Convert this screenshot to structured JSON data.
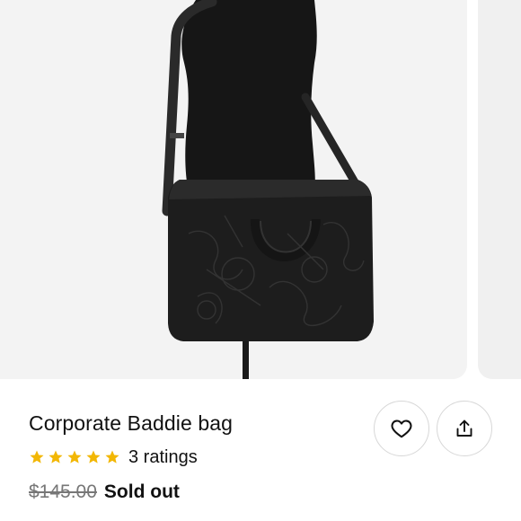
{
  "product": {
    "title": "Corporate Baddie bag",
    "rating_stars": 5,
    "rating_text": "3 ratings",
    "original_price": "$145.00",
    "status": "Sold out"
  },
  "actions": {
    "like_icon": "heart-icon",
    "share_icon": "share-icon"
  },
  "colors": {
    "star": "#F2B705",
    "sold_out": "#111111",
    "strike_price": "#777777"
  }
}
